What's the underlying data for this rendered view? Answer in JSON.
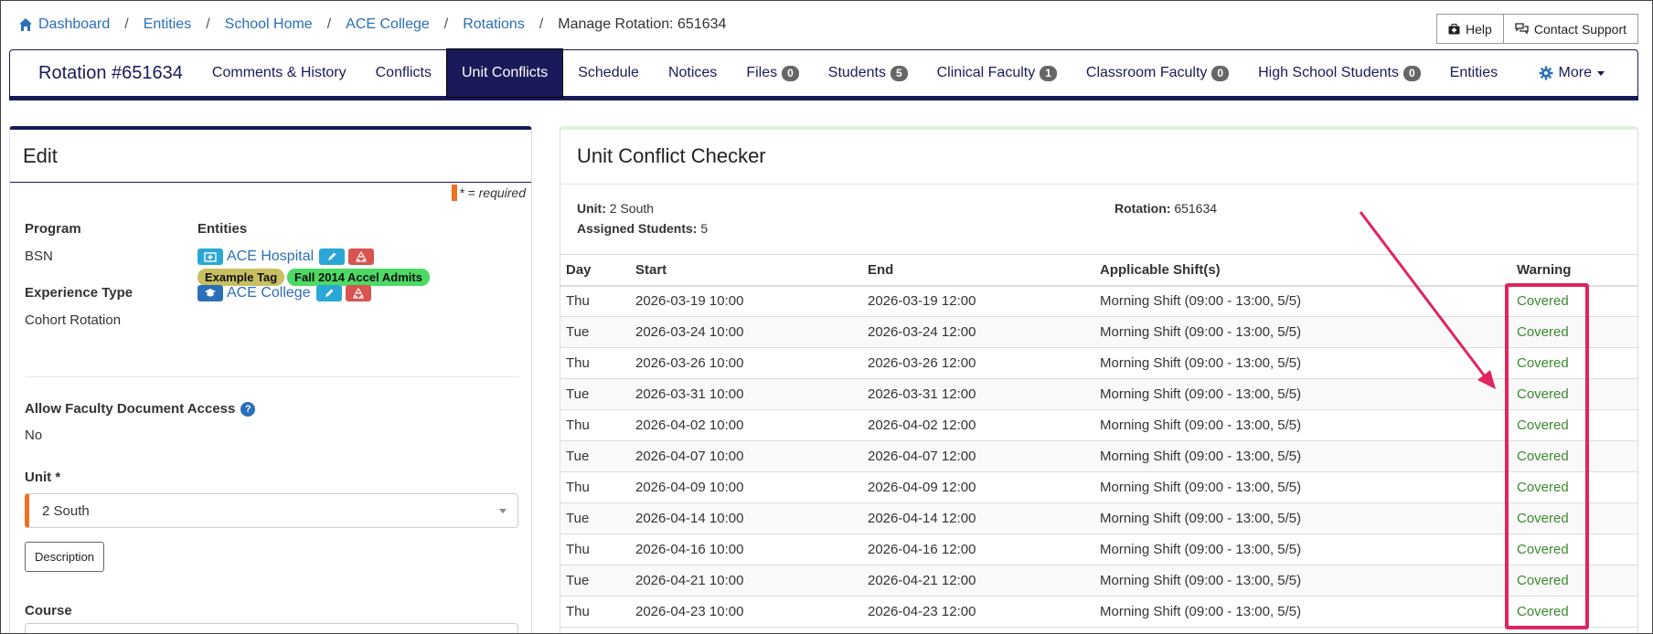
{
  "breadcrumb": {
    "items": [
      "Dashboard",
      "Entities",
      "School Home",
      "ACE College",
      "Rotations"
    ],
    "current": "Manage Rotation: 651634"
  },
  "top_buttons": {
    "help": "Help",
    "contact": "Contact Support"
  },
  "nav": {
    "title": "Rotation #651634",
    "items": [
      {
        "label": "Comments & History",
        "badge": null
      },
      {
        "label": "Conflicts",
        "badge": null
      },
      {
        "label": "Unit Conflicts",
        "badge": null,
        "active": true
      },
      {
        "label": "Schedule",
        "badge": null
      },
      {
        "label": "Notices",
        "badge": null
      },
      {
        "label": "Files",
        "badge": "0"
      },
      {
        "label": "Students",
        "badge": "5"
      },
      {
        "label": "Clinical Faculty",
        "badge": "1"
      },
      {
        "label": "Classroom Faculty",
        "badge": "0"
      },
      {
        "label": "High School Students",
        "badge": "0"
      },
      {
        "label": "Entities",
        "badge": null
      }
    ],
    "more": "More"
  },
  "edit": {
    "title": "Edit",
    "required_note": "* = required",
    "program_label": "Program",
    "program_value": "BSN",
    "entities_label": "Entities",
    "entity_hospital": "ACE Hospital",
    "tag_1": "Example Tag",
    "tag_2": "Fall 2014 Accel Admits",
    "entity_college": "ACE College",
    "experience_label": "Experience Type",
    "experience_value": "Cohort Rotation",
    "faculty_access_label": "Allow Faculty Document Access",
    "faculty_access_value": "No",
    "unit_label": "Unit *",
    "unit_value": "2 South",
    "description_button": "Description",
    "course_label": "Course"
  },
  "checker": {
    "title": "Unit Conflict Checker",
    "unit_label": "Unit:",
    "unit_value": "2 South",
    "assigned_label": "Assigned Students:",
    "assigned_value": "5",
    "rotation_label": "Rotation:",
    "rotation_value": "651634",
    "columns": [
      "Day",
      "Start",
      "End",
      "Applicable Shift(s)",
      "Warning"
    ],
    "rows": [
      [
        "Thu",
        "2026-03-19 10:00",
        "2026-03-19 12:00",
        "Morning Shift (09:00 - 13:00, 5/5)",
        "Covered"
      ],
      [
        "Tue",
        "2026-03-24 10:00",
        "2026-03-24 12:00",
        "Morning Shift (09:00 - 13:00, 5/5)",
        "Covered"
      ],
      [
        "Thu",
        "2026-03-26 10:00",
        "2026-03-26 12:00",
        "Morning Shift (09:00 - 13:00, 5/5)",
        "Covered"
      ],
      [
        "Tue",
        "2026-03-31 10:00",
        "2026-03-31 12:00",
        "Morning Shift (09:00 - 13:00, 5/5)",
        "Covered"
      ],
      [
        "Thu",
        "2026-04-02 10:00",
        "2026-04-02 12:00",
        "Morning Shift (09:00 - 13:00, 5/5)",
        "Covered"
      ],
      [
        "Tue",
        "2026-04-07 10:00",
        "2026-04-07 12:00",
        "Morning Shift (09:00 - 13:00, 5/5)",
        "Covered"
      ],
      [
        "Thu",
        "2026-04-09 10:00",
        "2026-04-09 12:00",
        "Morning Shift (09:00 - 13:00, 5/5)",
        "Covered"
      ],
      [
        "Tue",
        "2026-04-14 10:00",
        "2026-04-14 12:00",
        "Morning Shift (09:00 - 13:00, 5/5)",
        "Covered"
      ],
      [
        "Thu",
        "2026-04-16 10:00",
        "2026-04-16 12:00",
        "Morning Shift (09:00 - 13:00, 5/5)",
        "Covered"
      ],
      [
        "Tue",
        "2026-04-21 10:00",
        "2026-04-21 12:00",
        "Morning Shift (09:00 - 13:00, 5/5)",
        "Covered"
      ],
      [
        "Thu",
        "2026-04-23 10:00",
        "2026-04-23 12:00",
        "Morning Shift (09:00 - 13:00, 5/5)",
        "Covered"
      ]
    ]
  },
  "colors": {
    "navy": "#1a1a5a",
    "link": "#2a6fb8",
    "covered": "#3c8a2e",
    "highlight": "#e0245e",
    "required": "#f07020"
  }
}
